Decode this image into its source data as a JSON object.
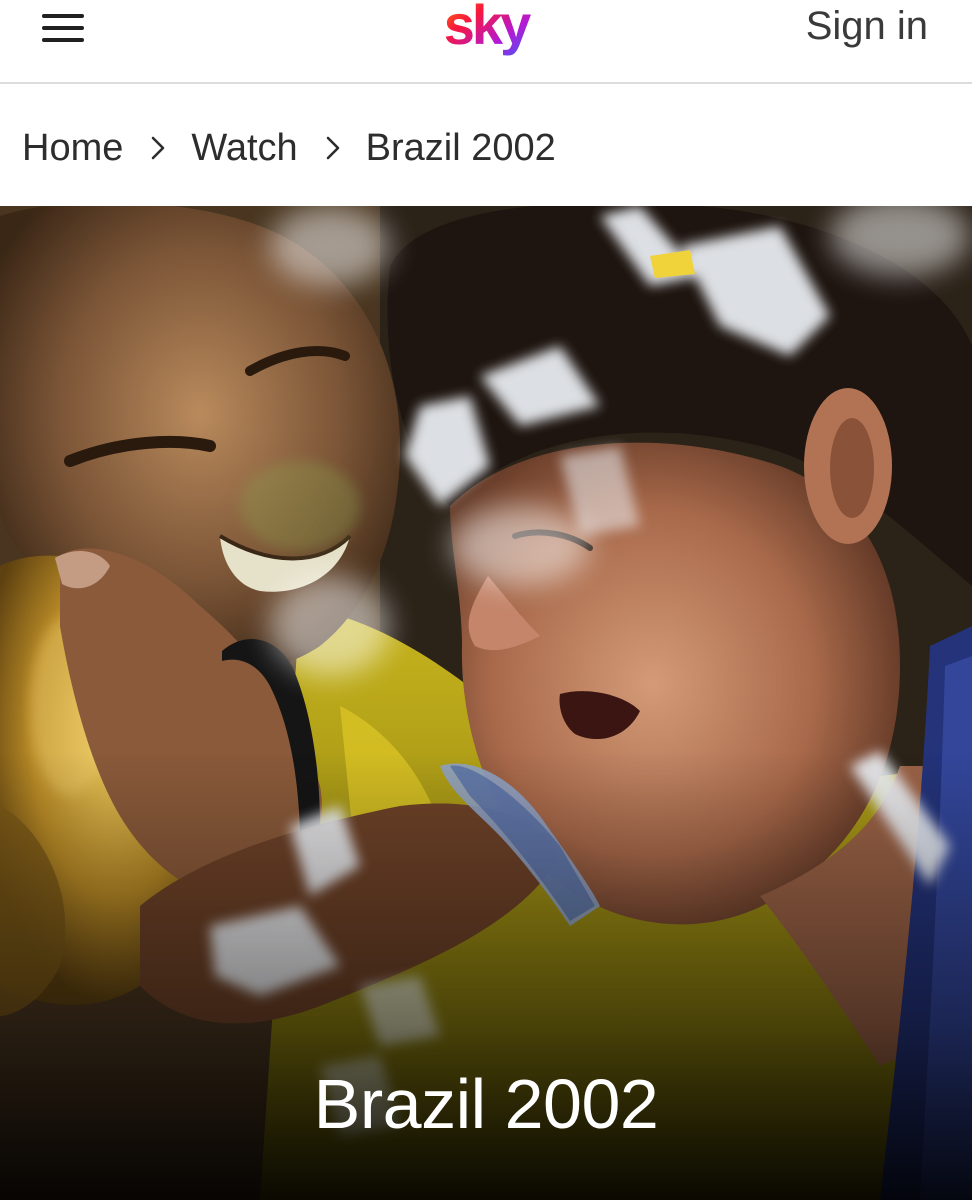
{
  "header": {
    "logo_text": "sky",
    "signin_label": "Sign in",
    "menu_icon": "hamburger-menu-icon",
    "logo_gradient": [
      "#ff8a00",
      "#f8173c",
      "#b21ad6",
      "#3f5cf5"
    ]
  },
  "breadcrumb": {
    "items": [
      {
        "label": "Home"
      },
      {
        "label": "Watch"
      },
      {
        "label": "Brazil 2002"
      }
    ],
    "separator_icon": "chevron-right-icon"
  },
  "hero": {
    "image_subject": "players kissing trophy amid confetti",
    "title": "Brazil 2002"
  }
}
